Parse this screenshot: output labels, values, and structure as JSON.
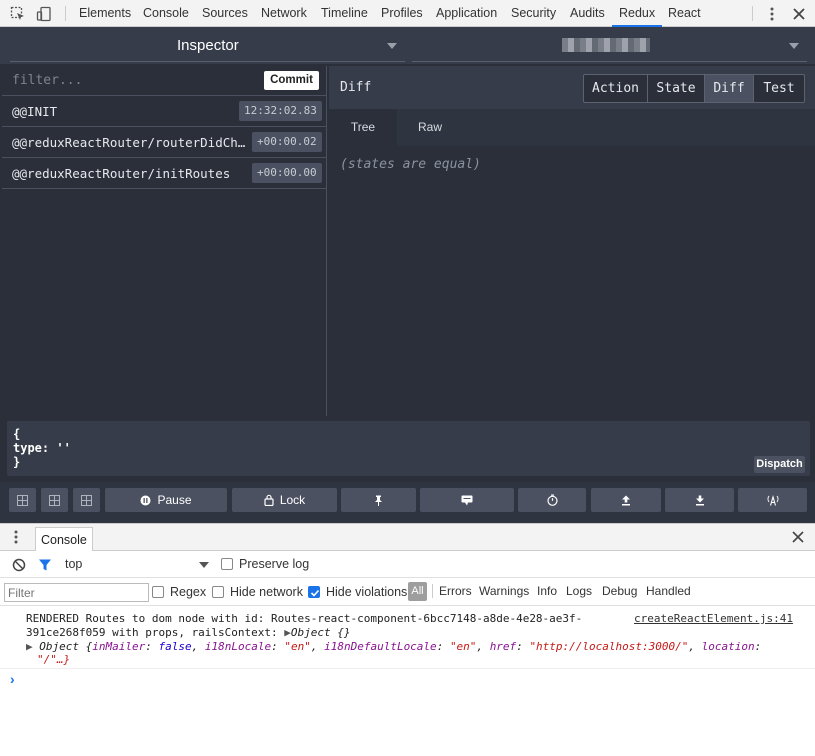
{
  "topbar": {
    "tabs": [
      "Elements",
      "Console",
      "Sources",
      "Network",
      "Timeline",
      "Profiles",
      "Application",
      "Security",
      "Audits",
      "Redux",
      "React"
    ],
    "active_tab": "Redux",
    "icons": [
      "inspect-element-icon",
      "device-toolbar-icon",
      "more-menu-icon",
      "close-icon"
    ]
  },
  "redux": {
    "monitor_select": "Inspector",
    "filter_placeholder": "filter...",
    "commit_label": "Commit",
    "actions": [
      {
        "name": "@@INIT",
        "time": "12:32:02.83"
      },
      {
        "name": "@@reduxReactRouter/routerDidChange",
        "time": "+00:00.02"
      },
      {
        "name": "@@reduxReactRouter/initRoutes",
        "time": "+00:00.00"
      }
    ],
    "pane_title": "Diff",
    "segments": [
      "Action",
      "State",
      "Diff",
      "Test"
    ],
    "active_segment": "Diff",
    "subtabs": [
      "Tree",
      "Raw"
    ],
    "active_subtab": "Tree",
    "diff_message": "(states are equal)",
    "dispatch_code": [
      "{",
      "type: ''",
      "}"
    ],
    "dispatch_label": "Dispatch",
    "bottom_buttons": {
      "pause_label": "Pause",
      "lock_label": "Lock"
    },
    "colors": {
      "panel_bg": "#2a2f3a",
      "header_bg": "#363c49",
      "button_bg": "#4b5160"
    }
  },
  "drawer": {
    "tab_label": "Console",
    "context_value": "top",
    "preserve_log_label": "Preserve log",
    "filter_placeholder": "Filter",
    "regex_label": "Regex",
    "hide_network_label": "Hide network",
    "hide_violations_label": "Hide violations",
    "hide_violations_checked": true,
    "levels": [
      "All",
      "Errors",
      "Warnings",
      "Info",
      "Logs",
      "Debug",
      "Handled"
    ],
    "active_level": "All"
  },
  "console": {
    "log_line1": "RENDERED Routes to dom node with id: Routes-react-component-6bcc7148-a8de-4e28-ae3f-",
    "log_line2_prefix": "391ce268f059 with props, railsContext: ",
    "log_line2_obj": "Object {}",
    "source_link": "createReactElement.js:41",
    "object_label": "Object",
    "props": [
      {
        "key": "inMailer",
        "value": "false",
        "kind": "kw"
      },
      {
        "key": "i18nLocale",
        "value": "\"en\"",
        "kind": "str"
      },
      {
        "key": "i18nDefaultLocale",
        "value": "\"en\"",
        "kind": "str"
      },
      {
        "key": "href",
        "value": "\"http://localhost:3000/\"",
        "kind": "str"
      },
      {
        "key": "location",
        "value": "",
        "kind": "name"
      }
    ],
    "continuation": "\"/\"…}",
    "prompt_symbol": "›"
  }
}
